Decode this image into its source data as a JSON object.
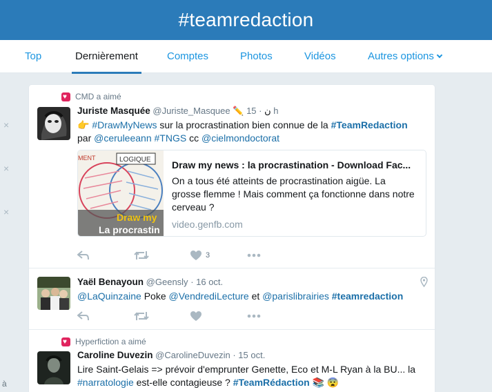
{
  "header": {
    "title": "#teamredaction"
  },
  "nav": {
    "tabs": [
      {
        "label": "Top"
      },
      {
        "label": "Dernièrement"
      },
      {
        "label": "Comptes"
      },
      {
        "label": "Photos"
      },
      {
        "label": "Vidéos"
      },
      {
        "label": "Autres options"
      }
    ]
  },
  "side": {
    "x_mark": "×",
    "bottom_text": "à"
  },
  "tweets": [
    {
      "context": "CMD a aimé",
      "name": "Juriste Masquée",
      "handle": "@Juriste_Masquee",
      "name_suffix": "✏️ ن",
      "time": "· 15 h",
      "text": {
        "emoji": "👉",
        "t1": "#DrawMyNews",
        "t2": " sur la procrastination bien connue de la ",
        "t3": "#TeamRedaction",
        "t4": "par ",
        "t5": "@ceruleeann",
        "t6": " ",
        "t7": "#TNGS",
        "t8": " cc ",
        "t9": "@cielmondoctorat"
      },
      "card": {
        "title": "Draw my news : la procrastination - Download Fac...",
        "description": "On a tous été atteints de procrastination aigüe. La grosse flemme ! Mais comment ça fonctionne dans notre cerveau ?",
        "domain": "video.genfb.com",
        "thumb_top_left": "MENT",
        "thumb_top_right": "LOGIQUE",
        "thumb_line1": "Draw my",
        "thumb_line2": "La procrastin"
      },
      "like_count": "3"
    },
    {
      "name": "Yaël Benayoun",
      "handle": "@Geensly",
      "time": "· 16 oct.",
      "text": {
        "t1": "@LaQuinzaine",
        "t2": " Poke ",
        "t3": "@VendrediLecture",
        "t4": " et ",
        "t5": "@parislibrairies",
        "t6": " ",
        "t7": "#teamredaction"
      }
    },
    {
      "context": "Hyperfiction a aimé",
      "name": "Caroline Duvezin",
      "handle": "@CarolineDuvezin",
      "time": "· 15 oct.",
      "text": {
        "t1": "Lire Saint-Gelais => prévoir d'emprunter Genette, Eco et M-L Ryan à la BU... la",
        "t2": "#narratologie",
        "t3": " est-elle contagieuse ? ",
        "t4": "#TeamRédaction",
        "t5": " 📚 😨"
      }
    }
  ],
  "icons": {
    "reply": "reply-icon",
    "retweet": "retweet-icon",
    "like": "heart-icon",
    "more": "more-icon",
    "location": "location-pin-icon"
  },
  "colors": {
    "header": "#2b7bb9",
    "link": "#1b6fa8",
    "like_badge": "#e0245e",
    "background": "#e6ecf0"
  }
}
